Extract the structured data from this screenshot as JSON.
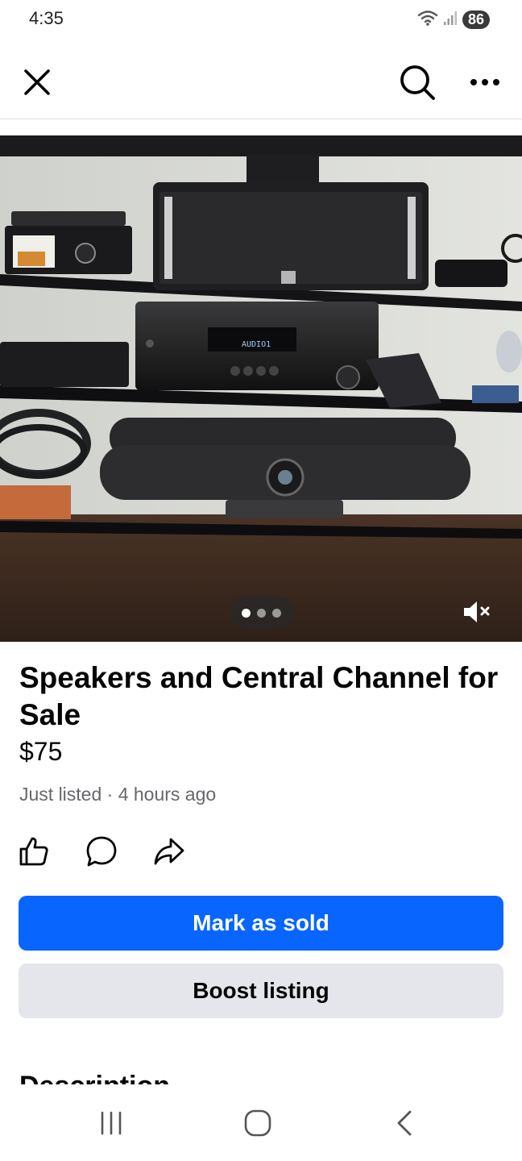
{
  "status_bar": {
    "time": "4:35",
    "battery": "86",
    "icons": [
      "wifi-icon",
      "signal-icon"
    ]
  },
  "top_bar": {
    "icons": [
      "close-icon",
      "search-icon",
      "more-options-icon"
    ]
  },
  "photo": {
    "pager_count": 3,
    "pager_active": 1,
    "receiver_display": "AUDIO1",
    "mute_icon": "volume-muted-icon"
  },
  "listing": {
    "title": "Speakers and Central Channel for Sale",
    "price": "$75",
    "meta": "Just listed · 4 hours ago"
  },
  "actions": {
    "icons": [
      "like-icon",
      "comment-icon",
      "share-icon"
    ]
  },
  "buttons": {
    "primary": "Mark as sold",
    "secondary": "Boost listing"
  },
  "section": {
    "heading": "Description"
  },
  "nav_bar": {
    "icons": [
      "recent-apps-icon",
      "home-icon",
      "back-icon"
    ]
  },
  "colors": {
    "primary_button": "#0866ff",
    "secondary_button": "#e4e6eb",
    "meta_text": "#65676b"
  }
}
